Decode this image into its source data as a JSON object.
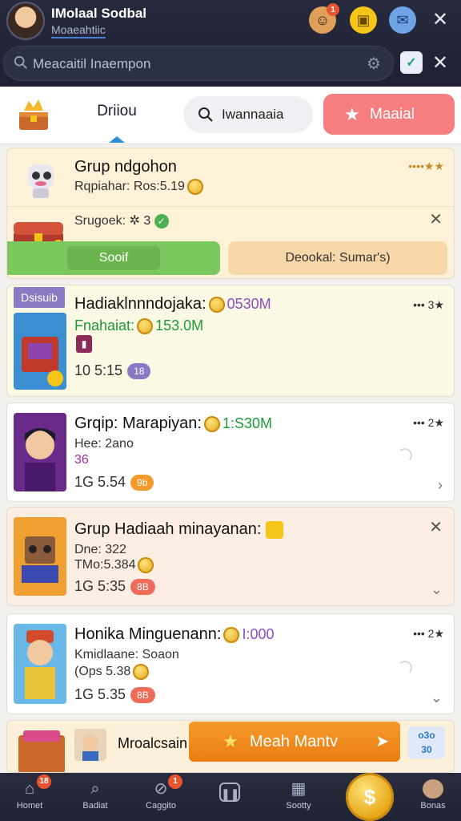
{
  "header": {
    "title": "IMolaal Sodbal",
    "subtitle": "Moaeahtiic",
    "notif_count": "1",
    "close_label": "✕"
  },
  "search": {
    "placeholder": "Meacaitil Inaempon",
    "value": "Meacaitil Inaempon"
  },
  "tabs": {
    "active": "Driiou",
    "search_tab": "Iwannaaia",
    "featured": "Maaial"
  },
  "cards": [
    {
      "title": "Grup ndgohon",
      "line1": "Rqpiahar: Ros:5.19",
      "dots": "••••★★",
      "sub_line": "Srugoek: ✲ 3",
      "btn_primary": "Sooif",
      "btn_secondary": "Deookal: Sumar's)"
    },
    {
      "tag": "Dsisuib",
      "title": "Hadiaklnnndojaka:",
      "title_value": "0530M",
      "line1": "Fnahaiat:",
      "line1_value": "153.0M",
      "meta": "10 5:15",
      "pill": "18",
      "dots": "••• 3★"
    },
    {
      "title": "Grqip: Marapiyan:",
      "title_value": "1:S30M",
      "line1": "Hee: 2ano",
      "line2": "36",
      "meta": "1G 5.54",
      "pill": "9b",
      "dots": "••• 2★"
    },
    {
      "title": "Grup  Hadiaah minayanan:",
      "line1": "Dne: 322",
      "line2": "TMo:5.384",
      "meta": "1G 5:35",
      "pill": "8B"
    },
    {
      "title": "Honika Minguenann:",
      "title_value": "I:000",
      "line1": "Kmidlaane: Soaon",
      "line2": "(Ops 5.38",
      "meta": "1G 5.35",
      "pill": "8B",
      "dots": "••• 2★"
    },
    {
      "title": "Mroalcsain",
      "cta": "Meah Mantv",
      "stat_top": "o3o",
      "stat_bottom": "30"
    }
  ],
  "nav": [
    {
      "label": "Homet",
      "badge": "18"
    },
    {
      "label": "Badiat"
    },
    {
      "label": "Caggito",
      "badge": "1"
    },
    {
      "label": ""
    },
    {
      "label": "Sootty"
    },
    {
      "label": ""
    },
    {
      "label": "Bonas"
    }
  ],
  "colors": {
    "topbar": "#272a3d",
    "featured_tab": "#f77e7e",
    "cta_orange": "#ea7d12",
    "green_button": "#7bc85f",
    "purple_pill": "#8a7ac4",
    "red_pill": "#ef6b5a"
  },
  "icons": [
    "search-icon",
    "gear-icon",
    "mail-icon",
    "close-icon",
    "chest-icon",
    "star-icon",
    "coin-icon",
    "home-icon",
    "search-nav-icon",
    "compass-icon",
    "pause-icon",
    "gift-icon",
    "coin-nav-icon",
    "avatar"
  ]
}
